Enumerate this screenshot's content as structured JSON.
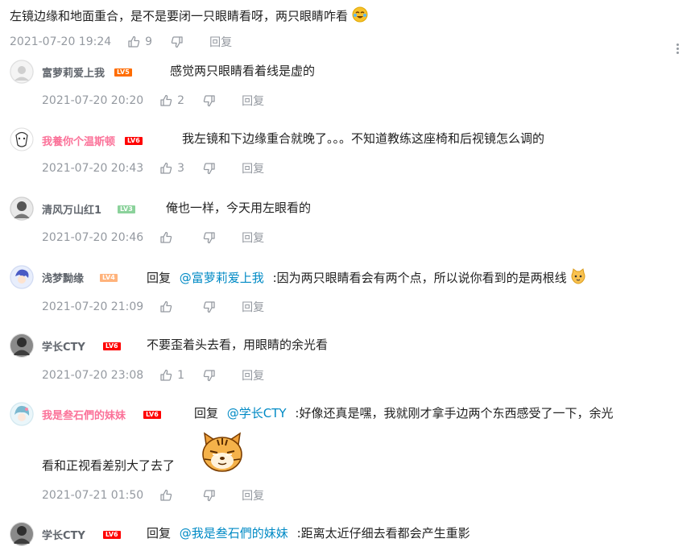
{
  "root_comment": {
    "text": "左镜边缘和地面重合，是不是要闭一只眼睛看呀，两只眼睛咋看",
    "emoji": "crying-laughing-emoji",
    "time": "2021-07-20 19:24",
    "likes": "9",
    "reply_label": "回复"
  },
  "replies": [
    {
      "username": "富萝莉爱上我",
      "level": "LV5",
      "content": "感觉两只眼睛看着线是虚的",
      "time": "2021-07-20 20:20",
      "likes": "2",
      "reply_label": "回复"
    },
    {
      "username": "我養你个温斯顿",
      "level": "LV6",
      "content": "我左镜和下边缘重合就晚了。。。不知道教练这座椅和后视镜怎么调的",
      "time": "2021-07-20 20:43",
      "likes": "3",
      "reply_label": "回复"
    },
    {
      "username": "清风万山红1",
      "level": "LV3",
      "content": "俺也一样，今天用左眼看的",
      "time": "2021-07-20 20:46",
      "likes": "",
      "reply_label": "回复"
    },
    {
      "username": "浅梦黝缘",
      "level": "LV4",
      "reply_prefix": "回复",
      "at_user": "@富萝莉爱上我",
      "content": ":因为两只眼睛看会有两个点，所以说你看到的是两根线",
      "emoji": "cat-emoji",
      "time": "2021-07-20 21:09",
      "likes": "",
      "reply_label": "回复"
    },
    {
      "username": "学长CTY",
      "level": "LV6",
      "content": "不要歪着头去看，用眼睛的余光看",
      "time": "2021-07-20 23:08",
      "likes": "1",
      "reply_label": "回复"
    },
    {
      "username": "我是叁石們的妹妹",
      "level": "LV6",
      "reply_prefix": "回复",
      "at_user": "@学长CTY",
      "content": ":好像还真是嘿，我就刚才拿手边两个东西感受了一下，余光",
      "content_line2": "看和正视看差别大了去了",
      "emoji": "tiger-sticker",
      "time": "2021-07-21 01:50",
      "likes": "",
      "reply_label": "回复"
    },
    {
      "username": "学长CTY",
      "level": "LV6",
      "reply_prefix": "回复",
      "at_user": "@我是叁石們的妹妹",
      "content": ":距离太近仔细去看都会产生重影"
    }
  ],
  "icons": {
    "like": "thumbs-up-icon",
    "dislike": "thumbs-down-icon",
    "more": "more-vertical-icon"
  }
}
